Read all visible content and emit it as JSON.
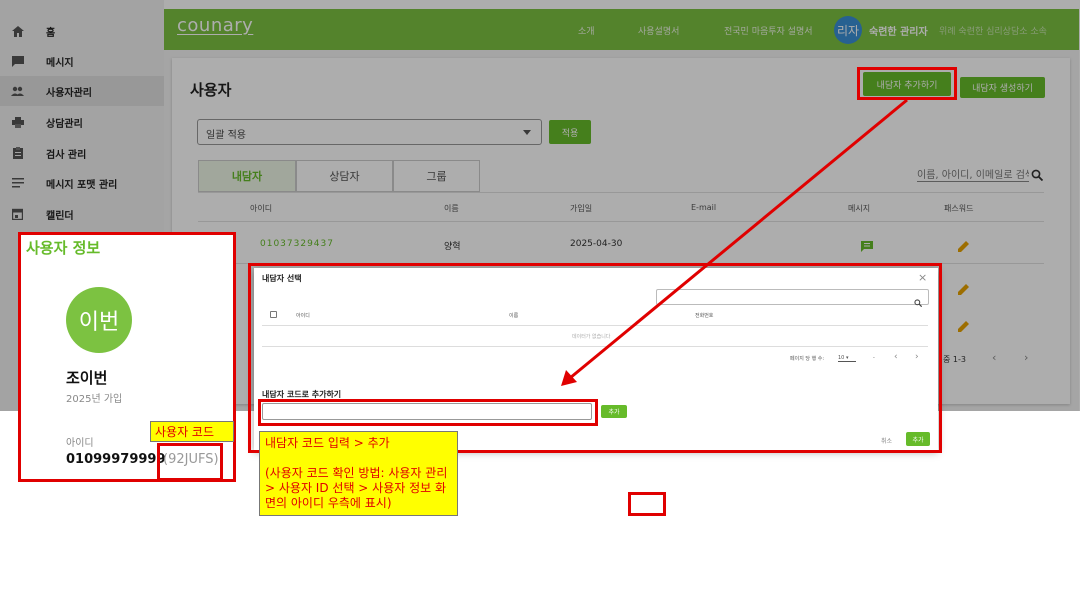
{
  "sidebar": {
    "items": [
      {
        "label": "홈",
        "icon": "home-icon"
      },
      {
        "label": "메시지",
        "icon": "message-icon"
      },
      {
        "label": "사용자관리",
        "icon": "users-icon"
      },
      {
        "label": "상담관리",
        "icon": "print-icon"
      },
      {
        "label": "검사 관리",
        "icon": "clipboard-icon"
      },
      {
        "label": "메시지 포맷 관리",
        "icon": "format-list-icon"
      },
      {
        "label": "캘린더",
        "icon": "calendar-icon"
      }
    ]
  },
  "topbar": {
    "logo": "counary",
    "nav": [
      "소개",
      "사용설명서",
      "전국민 마음투자 설명서"
    ],
    "avatar_initials": "리자",
    "admin_name": "숙련한 관리자",
    "admin_org": "위례 숙련한 심리상담소 소속"
  },
  "page": {
    "title": "사용자",
    "add_client_button": "내담자 추가하기",
    "create_client_button": "내담자 생성하기",
    "bulk_select_value": "일괄 적용",
    "apply_button": "적용",
    "tabs": [
      "내담자",
      "상담자",
      "그룹"
    ],
    "search_placeholder": "이름, 아이디, 이메일로 검색",
    "table_headers": [
      "아이디",
      "이름",
      "가입일",
      "E-mail",
      "메시지",
      "패스워드"
    ],
    "row": {
      "id": "01037329437",
      "name": "양혁",
      "joined": "2025-04-30"
    },
    "pagination_range": "중 1-3"
  },
  "modal": {
    "title": "내담자 선택",
    "headers": [
      "아이디",
      "이름",
      "전화번호"
    ],
    "empty_text": "데이터가 없습니다",
    "rows_per_page_label": "페이지 당 행 수:",
    "rows_per_page_value": "10",
    "range_text": "-",
    "code_label": "내담자 코드로 추가하기",
    "add_button": "추가",
    "cancel_button": "취소",
    "confirm_button": "추가"
  },
  "profile": {
    "section_title": "사용자 정보",
    "avatar_text": "이번",
    "name": "조이번",
    "joined": "2025년 가입",
    "id_label": "아이디",
    "id_value": "01099979999",
    "user_code": "(92JUFS)"
  },
  "annotations": {
    "user_code_callout": "사용자 코드",
    "instruction_title": "내담자 코드 입력 > 추가",
    "instruction_body": "(사용자 코드 확인 방법: 사용자 관리 > 사용자 ID 선택 > 사용자 정보 화면의 아이디 우측에 표시)"
  },
  "colors": {
    "brand_green": "#7cc241",
    "button_green": "#66bb2a",
    "annotation_red": "#e00000",
    "callout_yellow": "#ffff00"
  }
}
